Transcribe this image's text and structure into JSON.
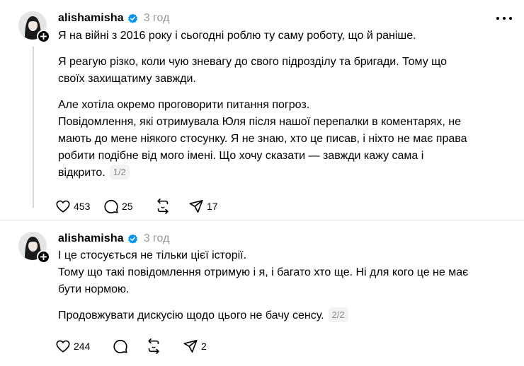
{
  "colors": {
    "text": "#000000",
    "muted": "#999999",
    "thread_line": "#d8d8d8",
    "accent_verified": "#0095f6"
  },
  "posts": [
    {
      "username": "alishamisha",
      "time": "3 год",
      "paragraphs": [
        [
          "Я на війні з 2016 року і сьогодні роблю ту саму роботу, що й раніше."
        ],
        [
          "Я реагую різко, коли чую зневагу до свого підрозділу та бригади. Тому що",
          "своїх захищатиму завжди."
        ],
        [
          "Але хотіла окремо проговорити питання погроз.",
          "Повідомлення, які отримувала Юля після нашої перепалки в коментарях, не",
          "мають до мене ніякого стосунку. Я не знаю, хто це писав, і ніхто не має права",
          "робити подібне від мого імені. Що хочу сказати — завжди кажу сама і",
          "відкрито."
        ]
      ],
      "counter": "1/2",
      "likes": "453",
      "replies": "25",
      "reposts": "",
      "shares": "17",
      "icons": [
        "heart-icon",
        "comment-icon",
        "repost-icon",
        "share-icon",
        "more-icon",
        "verified-badge-icon",
        "plus-icon"
      ]
    },
    {
      "username": "alishamisha",
      "time": "3 год",
      "paragraphs": [
        [
          "І це стосується не тільки цієї історії.",
          "Тому що такі повідомлення отримую і я, і багато хто ще. Ні для кого це не має",
          "бути нормою."
        ],
        [
          "Продовжувати дискусію щодо цього не бачу сенсу."
        ]
      ],
      "counter": "2/2",
      "likes": "244",
      "replies": "",
      "reposts": "",
      "shares": "2",
      "icons": [
        "heart-icon",
        "comment-icon",
        "repost-icon",
        "share-icon",
        "more-icon",
        "verified-badge-icon",
        "plus-icon"
      ]
    }
  ]
}
